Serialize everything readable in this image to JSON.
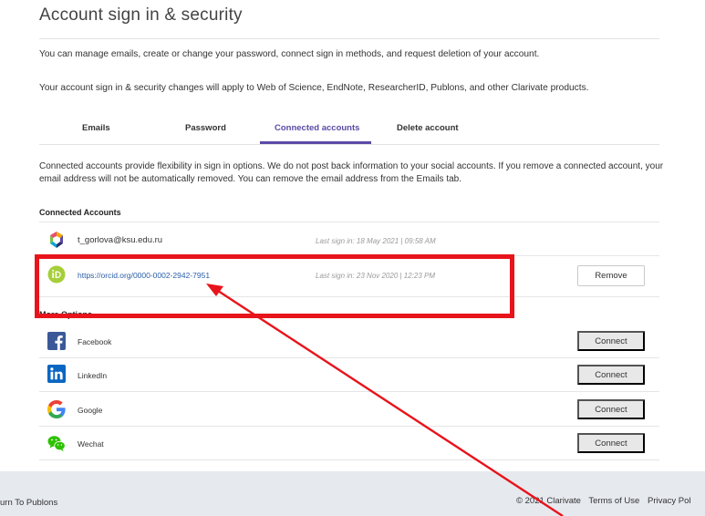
{
  "page": {
    "title": "Account sign in & security",
    "intro_1": "You can manage emails, create or change your password, connect sign in methods, and request deletion of your account.",
    "intro_2": "Your account sign in & security changes will apply to Web of Science, EndNote, ResearcherID, Publons, and other Clarivate products."
  },
  "tabs": [
    {
      "label": "Emails"
    },
    {
      "label": "Password"
    },
    {
      "label": "Connected accounts",
      "active": true
    },
    {
      "label": "Delete account"
    }
  ],
  "description": "Connected accounts provide flexibility in sign in options. We do not post back information to your social accounts. If you remove a connected account, your email address will not be automatically removed. You can remove the email address from the Emails tab.",
  "connected": {
    "heading": "Connected Accounts",
    "items": [
      {
        "label": "t_gorlova@ksu.edu.ru",
        "last_sign_in": "Last sign in: 18 May 2021 | 09:58 AM",
        "icon": "clarivate-logo-icon"
      },
      {
        "label": "https://orcid.org/0000-0002-2942-7951",
        "last_sign_in": "Last sign in: 23 Nov 2020 | 12:23 PM",
        "icon": "orcid-icon",
        "button": "Remove"
      }
    ]
  },
  "options": {
    "heading": "More Options",
    "items": [
      {
        "label": "Facebook",
        "button": "Connect",
        "icon": "facebook-icon",
        "color": "#3b5998"
      },
      {
        "label": "LinkedIn",
        "button": "Connect",
        "icon": "linkedin-icon",
        "color": "#0a66c2"
      },
      {
        "label": "Google",
        "button": "Connect",
        "icon": "google-icon"
      },
      {
        "label": "Wechat",
        "button": "Connect",
        "icon": "wechat-icon",
        "color": "#2dc100"
      }
    ]
  },
  "footer": {
    "return_link": "urn To Publons",
    "copyright": "© 2021 Clarivate",
    "terms": "Terms of Use",
    "privacy": "Privacy Pol"
  },
  "annotation": {
    "highlight_color": "#e8141b"
  }
}
